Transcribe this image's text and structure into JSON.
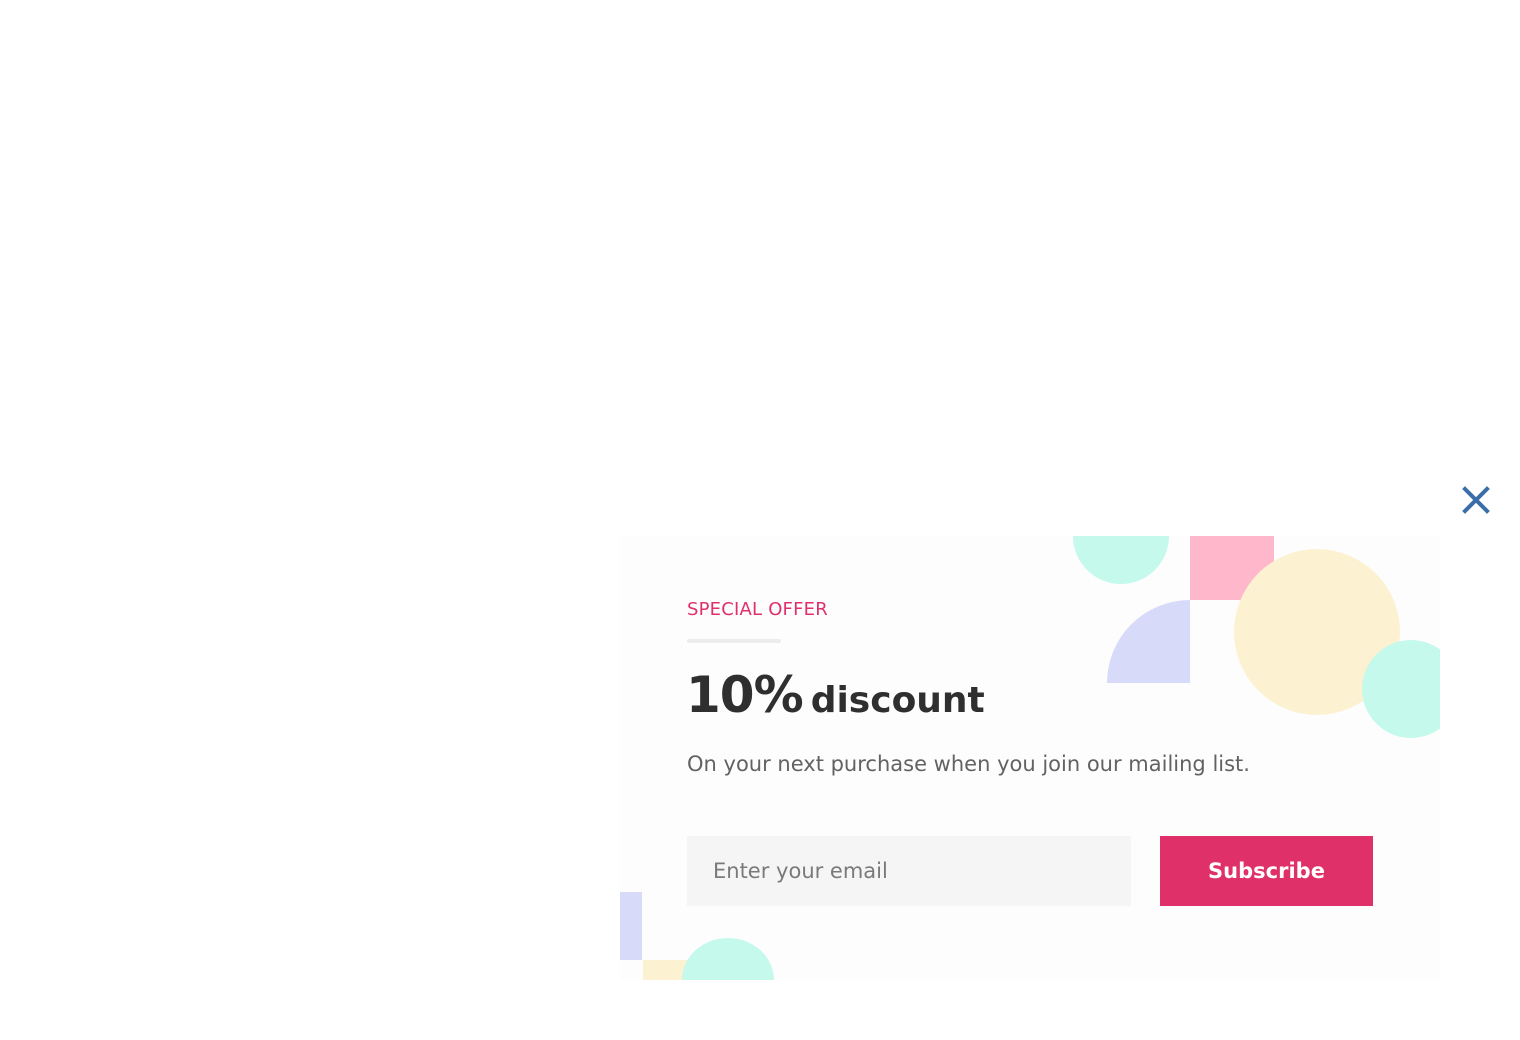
{
  "close": {
    "icon": "close-icon",
    "color": "#3a6ea8"
  },
  "offer": {
    "eyebrow": "SPECIAL OFFER",
    "headline_value": "10%",
    "headline_text": "discount",
    "subtext": "On your next purchase when you join our mailing list."
  },
  "form": {
    "email_placeholder": "Enter your email",
    "email_value": "",
    "subscribe_label": "Subscribe"
  },
  "theme": {
    "accent": "#e0306a",
    "text_dark": "#2f2f2f",
    "text_muted": "#626262",
    "shape_mint": "#c4f9ec",
    "shape_pink": "#ffb8cb",
    "shape_lavender": "#d8daf9",
    "shape_cream": "#fcf1d1"
  }
}
